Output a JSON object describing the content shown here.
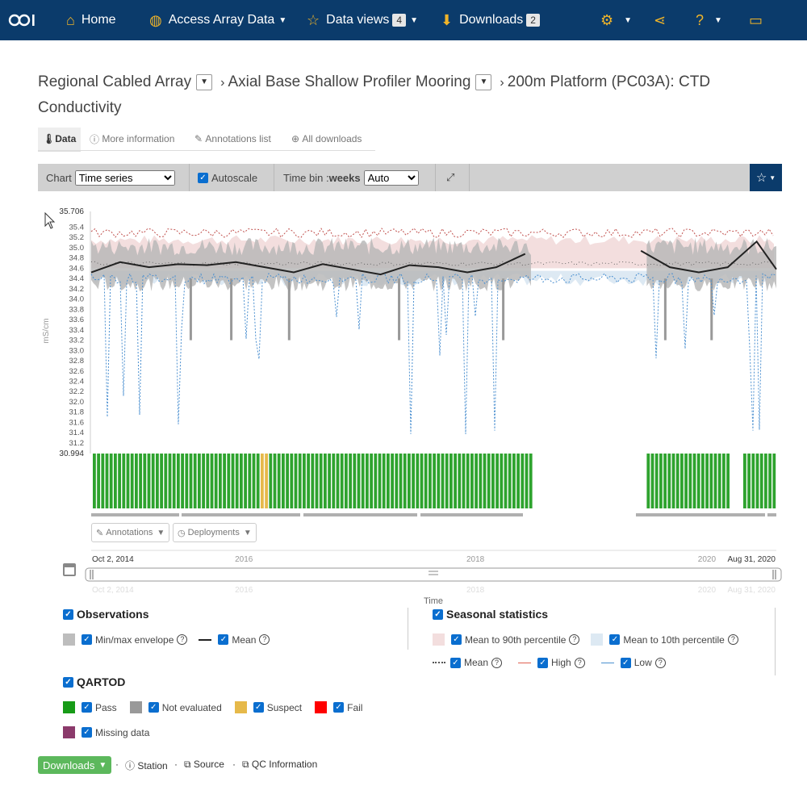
{
  "nav": {
    "home": "Home",
    "access": "Access Array Data",
    "dataviews": "Data views",
    "dataviews_count": "4",
    "downloads": "Downloads",
    "downloads_count": "2"
  },
  "breadcrumb": {
    "array": "Regional Cabled Array",
    "site": "Axial Base Shallow Profiler Mooring",
    "instrument": "200m Platform (PC03A): CTD",
    "parameter": "Conductivity"
  },
  "tabs": [
    "Data",
    "More information",
    "Annotations list",
    "All downloads"
  ],
  "toolbar": {
    "chart_label": "Chart",
    "chart_value": "Time series",
    "autoscale": "Autoscale",
    "timebin_label": "Time bin : ",
    "timebin_unit": "weeks",
    "timebin_value": "Auto"
  },
  "chart_data": {
    "type": "line",
    "ylabel": "mS/cm",
    "xlabel": "Time",
    "y_max_label": "35.706",
    "y_min_label": "30.994",
    "ylim": [
      30.994,
      35.706
    ],
    "yticks": [
      "35.4",
      "35.2",
      "35.0",
      "34.8",
      "34.6",
      "34.4",
      "34.2",
      "34.0",
      "33.8",
      "33.6",
      "33.4",
      "33.2",
      "33.0",
      "32.8",
      "32.6",
      "32.4",
      "32.2",
      "32.0",
      "31.8",
      "31.6",
      "31.4",
      "31.2"
    ],
    "xticks": [
      "2016",
      "2018",
      "2020"
    ],
    "range_start": "Oct 2, 2014",
    "range_end": "Aug 31, 2020",
    "series": [
      {
        "name": "Mean",
        "x": [
          2014.75,
          2015.0,
          2015.25,
          2015.5,
          2015.75,
          2016.0,
          2016.25,
          2016.5,
          2016.75,
          2017.0,
          2017.25,
          2017.5,
          2017.75,
          2018.0,
          2018.25,
          2018.5,
          2019.5,
          2019.75,
          2020.0,
          2020.25,
          2020.5,
          2020.67
        ],
        "y": [
          34.52,
          34.72,
          34.62,
          34.68,
          34.66,
          34.72,
          34.62,
          34.52,
          34.68,
          34.58,
          34.48,
          34.66,
          34.62,
          34.52,
          34.62,
          34.88,
          34.94,
          34.62,
          34.52,
          34.62,
          35.12,
          34.58
        ]
      }
    ]
  },
  "buttons": {
    "annotations": "Annotations",
    "deployments": "Deployments"
  },
  "legend": {
    "observations": "Observations",
    "minmax": "Min/max envelope",
    "mean": "Mean",
    "seasonal": "Seasonal statistics",
    "mean90": "Mean to 90th percentile",
    "mean10": "Mean to 10th percentile",
    "smean": "Mean",
    "high": "High",
    "low": "Low",
    "qartod": "QARTOD",
    "pass": "Pass",
    "noteval": "Not evaluated",
    "suspect": "Suspect",
    "fail": "Fail",
    "missing": "Missing data"
  },
  "colors": {
    "nav_bg": "#0b3b6b",
    "pass": "#2ea32e",
    "not_evaluated": "#999999",
    "suspect": "#e6b94a",
    "fail": "#ff0000",
    "missing": "#8b3a6b",
    "pct90": "#f3dede",
    "pct10": "#dde9f3",
    "high": "#e06050",
    "low": "#4a8fd0"
  },
  "footer": {
    "downloads": "Downloads",
    "station": "Station",
    "source": "Source",
    "qc": "QC Information"
  }
}
